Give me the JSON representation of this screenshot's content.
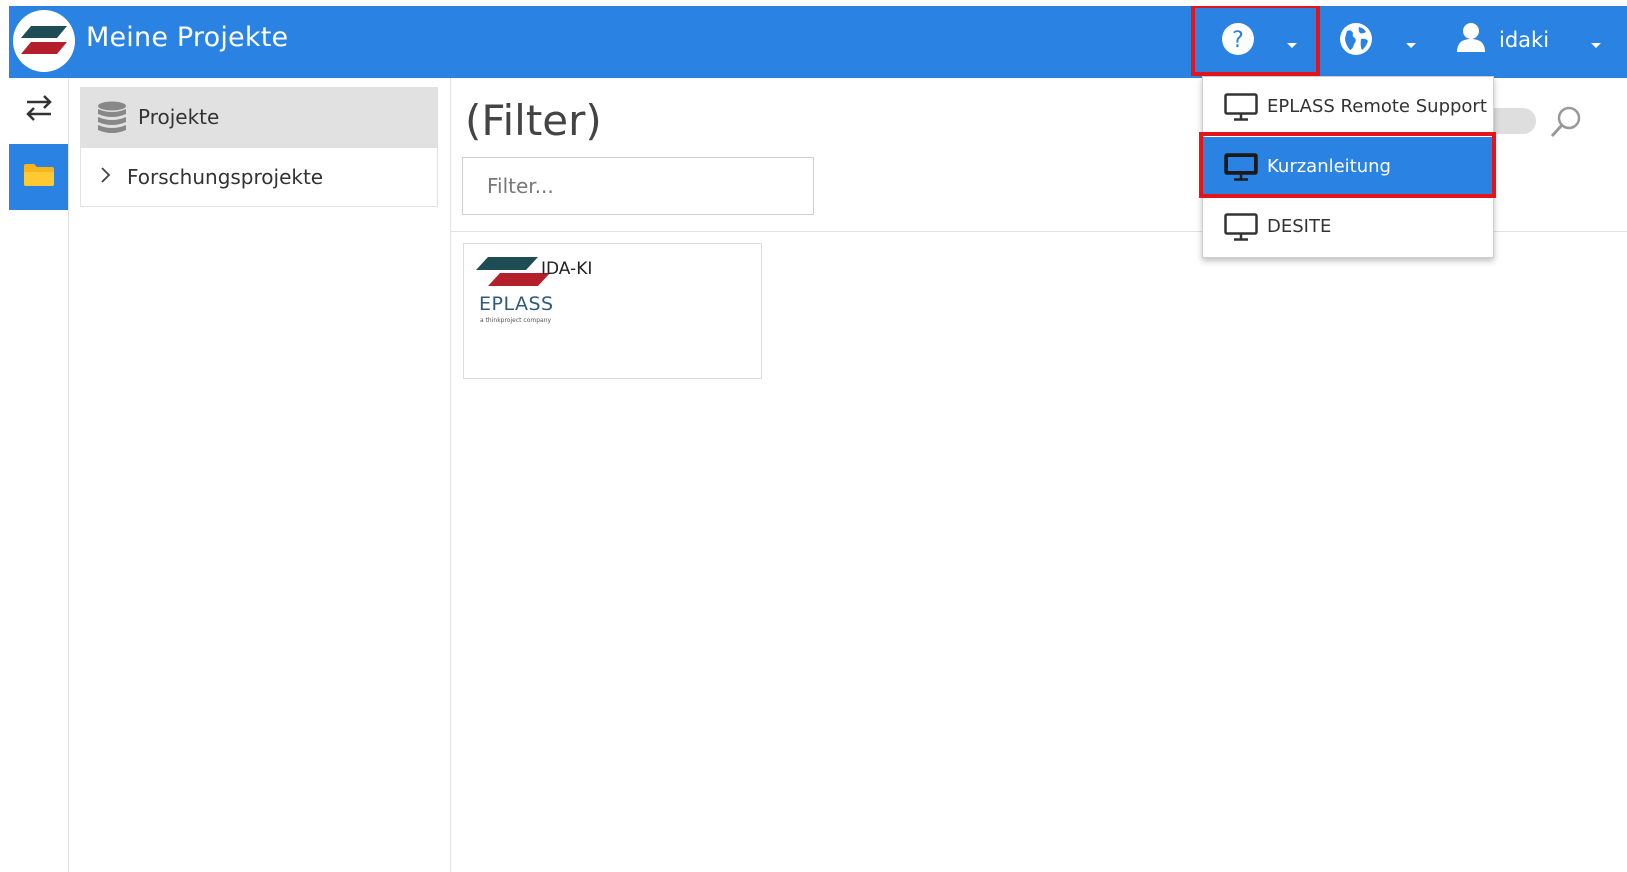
{
  "header": {
    "title": "Meine Projekte",
    "help_icon": "question-circle-icon",
    "language_icon": "globe-icon",
    "user_icon": "user-icon",
    "username": "idaki",
    "accent_color": "#2a83e2",
    "highlight_color": "#e5141b"
  },
  "rail": {
    "items": [
      {
        "icon": "swap-arrows-icon",
        "active": false
      },
      {
        "icon": "folder-icon",
        "active": true
      }
    ]
  },
  "tree": {
    "root_icon": "database-icon",
    "root_label": "Projekte",
    "children": [
      {
        "label": "Forschungsprojekte",
        "icon": "chevron-right-icon"
      }
    ]
  },
  "main": {
    "title": "(Filter)",
    "filter_placeholder": "Filter...",
    "search_icon": "search-icon",
    "projects": [
      {
        "title": "IDA-KI",
        "brand": "EPLASS",
        "brand_sub": "a thinkproject company"
      }
    ]
  },
  "help_menu": {
    "items": [
      {
        "label": "EPLASS Remote Support",
        "icon": "monitor-icon",
        "active": false
      },
      {
        "label": "Kurzanleitung",
        "icon": "monitor-icon",
        "active": true
      },
      {
        "label": "DESITE",
        "icon": "monitor-icon",
        "active": false
      }
    ]
  }
}
